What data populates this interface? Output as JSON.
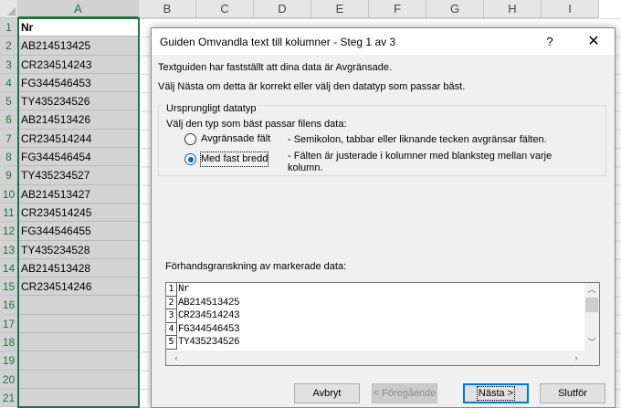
{
  "spreadsheet": {
    "columns": [
      "A",
      "B",
      "C",
      "D",
      "E",
      "F",
      "G",
      "H",
      "I"
    ],
    "rows": [
      "1",
      "2",
      "3",
      "4",
      "5",
      "6",
      "7",
      "8",
      "9",
      "10",
      "11",
      "12",
      "13",
      "14",
      "15",
      "16",
      "17",
      "18",
      "19",
      "20",
      "21"
    ],
    "columnA": [
      "Nr",
      "AB214513425",
      "CR234514243",
      "FG344546453",
      "TY435234526",
      "AB214513426",
      "CR234514244",
      "FG344546454",
      "TY435234527",
      "AB214513427",
      "CR234514245",
      "FG344546455",
      "TY435234528",
      "AB214513428",
      "CR234514246",
      "",
      "",
      "",
      "",
      "",
      ""
    ]
  },
  "dialog": {
    "title": "Guiden Omvandla text till kolumner - Steg 1 av 3",
    "help_label": "?",
    "close_label": "✕",
    "intro_line1": "Textguiden har fastställt att dina data är Avgränsade.",
    "intro_line2": "Välj Nästa om detta är korrekt eller välj den datatyp som passar bäst.",
    "group": {
      "legend": "Ursprungligt datatyp",
      "instruction": "Välj den typ som bäst passar filens data:",
      "options": [
        {
          "label": "Avgränsade fält",
          "description": "- Semikolon, tabbar eller liknande tecken avgränsar fälten.",
          "checked": false
        },
        {
          "label": "Med fast bredd",
          "description": "- Fälten är justerade i kolumner med blanksteg mellan varje kolumn.",
          "checked": true
        }
      ]
    },
    "preview": {
      "label": "Förhandsgranskning av markerade data:",
      "rows": [
        {
          "num": "1",
          "text": "Nr"
        },
        {
          "num": "2",
          "text": "AB214513425"
        },
        {
          "num": "3",
          "text": "CR234514243"
        },
        {
          "num": "4",
          "text": "FG344546453"
        },
        {
          "num": "5",
          "text": "TY435234526"
        }
      ]
    },
    "buttons": {
      "cancel": "Avbryt",
      "back": "< Föregående",
      "next": "Nästa >",
      "finish": "Slutför"
    }
  },
  "colors": {
    "excel_green": "#217346",
    "selection_fill": "#d3d3d3",
    "radio_accent": "#0063b1",
    "default_button_border": "#0078d7"
  }
}
